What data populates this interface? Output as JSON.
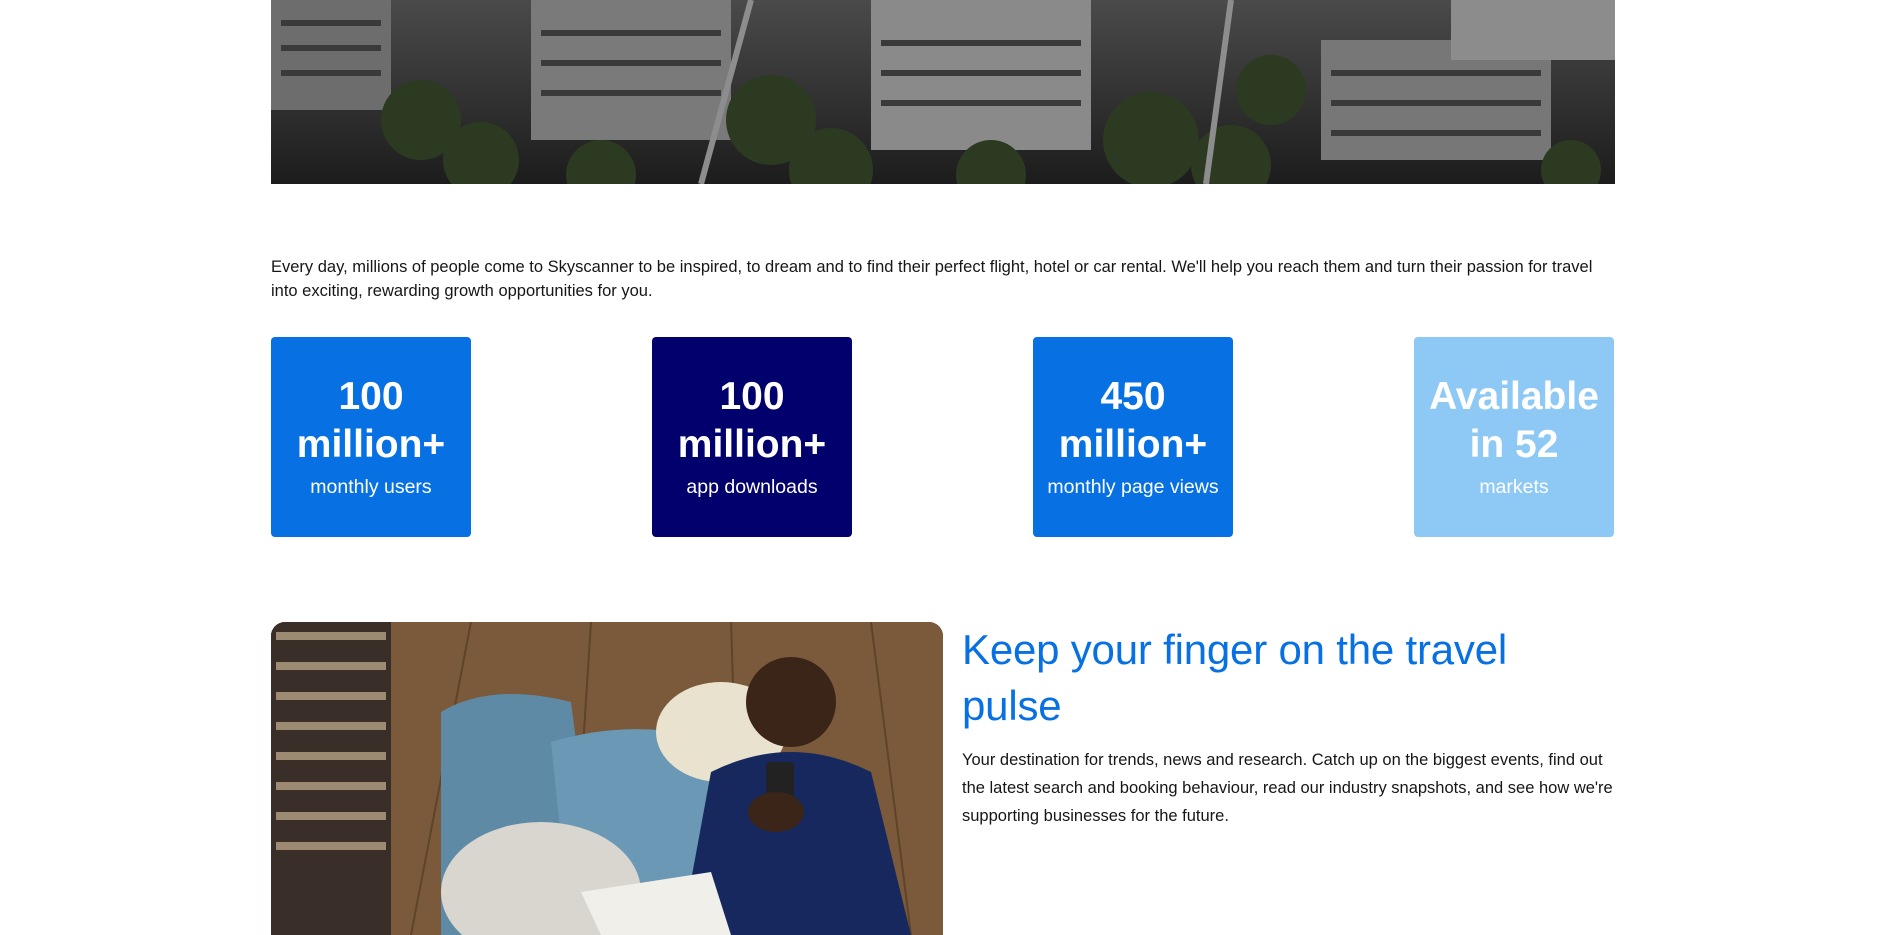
{
  "intro": {
    "text": "Every day, millions of people come to Skyscanner to be inspired, to dream and to find their perfect flight, hotel or car rental. We'll help you reach them and turn their passion for travel into exciting, rewarding growth opportunities for you."
  },
  "stats": [
    {
      "big": "100 million+",
      "small": "monthly users",
      "color": "#0770e3"
    },
    {
      "big": "100 million+",
      "small": "app downloads",
      "color": "#02006c"
    },
    {
      "big": "450 million+",
      "small": "monthly page views",
      "color": "#0770e3"
    },
    {
      "big": "Available in 52",
      "small": "markets",
      "color": "#8ec9f5"
    }
  ],
  "feature": {
    "title": "Keep your finger on the travel pulse",
    "body": "Your destination for trends, news and research. Catch up on the biggest events, find out the latest search and booking behaviour, read our industry snapshots, and see how we're supporting businesses for the future."
  },
  "colors": {
    "brand_blue": "#0770e3",
    "navy": "#02006c",
    "light_blue": "#8ec9f5"
  }
}
